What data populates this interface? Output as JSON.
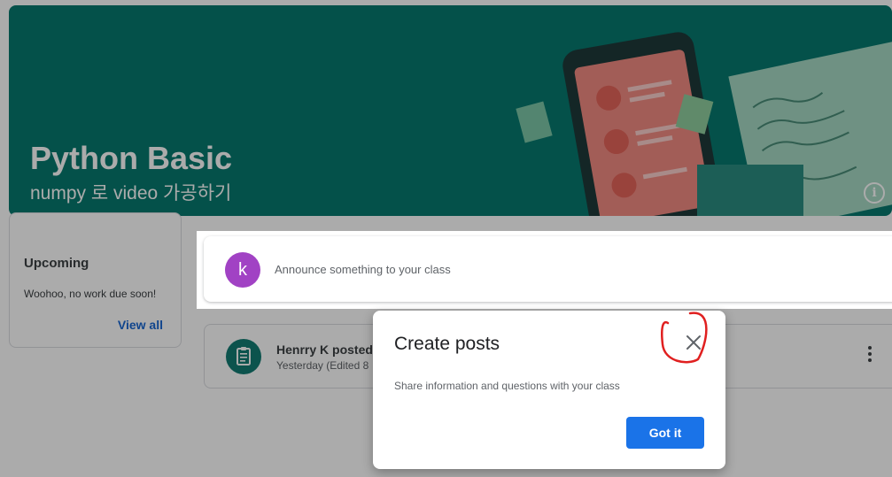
{
  "banner": {
    "title": "Python Basic",
    "subtitle": "numpy 로 video 가공하기",
    "info_icon_glyph": "i",
    "color": "#067a6f"
  },
  "upcoming": {
    "title": "Upcoming",
    "text": "Woohoo, no work due soon!",
    "link": "View all"
  },
  "announce": {
    "avatar_letter": "k",
    "placeholder": "Announce something to your class",
    "avatar_color": "#a142c4"
  },
  "post": {
    "author_text": "Henrry K posted",
    "time_text": "Yesterday (Edited 8",
    "icon": "assignment-icon"
  },
  "dialog": {
    "title": "Create posts",
    "body": "Share information and questions with your class",
    "button": "Got it",
    "close_icon": "close-icon",
    "button_color": "#1a73e8"
  }
}
